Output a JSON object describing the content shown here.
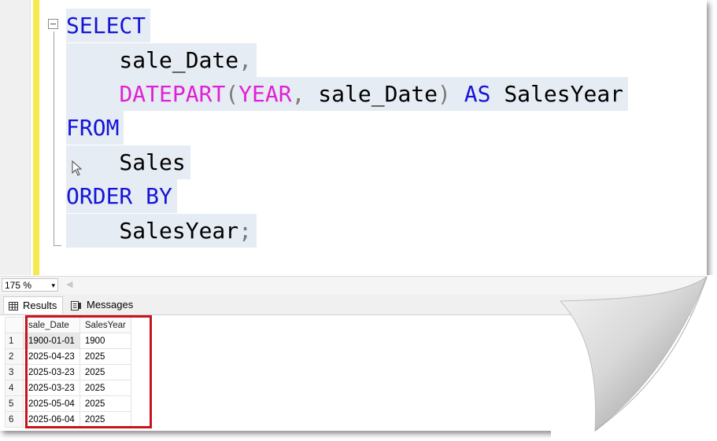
{
  "editor": {
    "lines": [
      {
        "parts": [
          {
            "t": "SELECT",
            "c": "kw"
          }
        ]
      },
      {
        "parts": [
          {
            "t": "    sale_Date",
            "c": ""
          },
          {
            "t": ",",
            "c": "op"
          }
        ]
      },
      {
        "parts": [
          {
            "t": "    ",
            "c": ""
          },
          {
            "t": "DATEPART",
            "c": "fn"
          },
          {
            "t": "(",
            "c": "op"
          },
          {
            "t": "YEAR",
            "c": "fn"
          },
          {
            "t": ",",
            "c": "op"
          },
          {
            "t": " sale_Date",
            "c": ""
          },
          {
            "t": ")",
            "c": "op"
          },
          {
            "t": " AS",
            "c": "kw"
          },
          {
            "t": " SalesYear",
            "c": ""
          }
        ]
      },
      {
        "parts": [
          {
            "t": "FROM",
            "c": "kw"
          }
        ]
      },
      {
        "parts": [
          {
            "t": "    Sales",
            "c": ""
          }
        ]
      },
      {
        "parts": [
          {
            "t": "ORDER BY",
            "c": "kw"
          }
        ]
      },
      {
        "parts": [
          {
            "t": "    SalesYear",
            "c": ""
          },
          {
            "t": ";",
            "c": "op"
          }
        ]
      }
    ]
  },
  "zoom": {
    "value": "175 %",
    "arrow": "▾"
  },
  "tabs": {
    "results": "Results",
    "messages": "Messages"
  },
  "grid": {
    "columns": [
      "sale_Date",
      "SalesYear"
    ],
    "rows": [
      {
        "num": "1",
        "sale_Date": "1900-01-01",
        "SalesYear": "1900"
      },
      {
        "num": "2",
        "sale_Date": "2025-04-23",
        "SalesYear": "2025"
      },
      {
        "num": "3",
        "sale_Date": "2025-03-23",
        "SalesYear": "2025"
      },
      {
        "num": "4",
        "sale_Date": "2025-03-23",
        "SalesYear": "2025"
      },
      {
        "num": "5",
        "sale_Date": "2025-05-04",
        "SalesYear": "2025"
      },
      {
        "num": "6",
        "sale_Date": "2025-06-04",
        "SalesYear": "2025"
      }
    ]
  },
  "colors": {
    "keyword": "#1414d8",
    "function": "#e020d6",
    "highlight_box": "#c8141e",
    "change_bar": "#f7e84c"
  }
}
